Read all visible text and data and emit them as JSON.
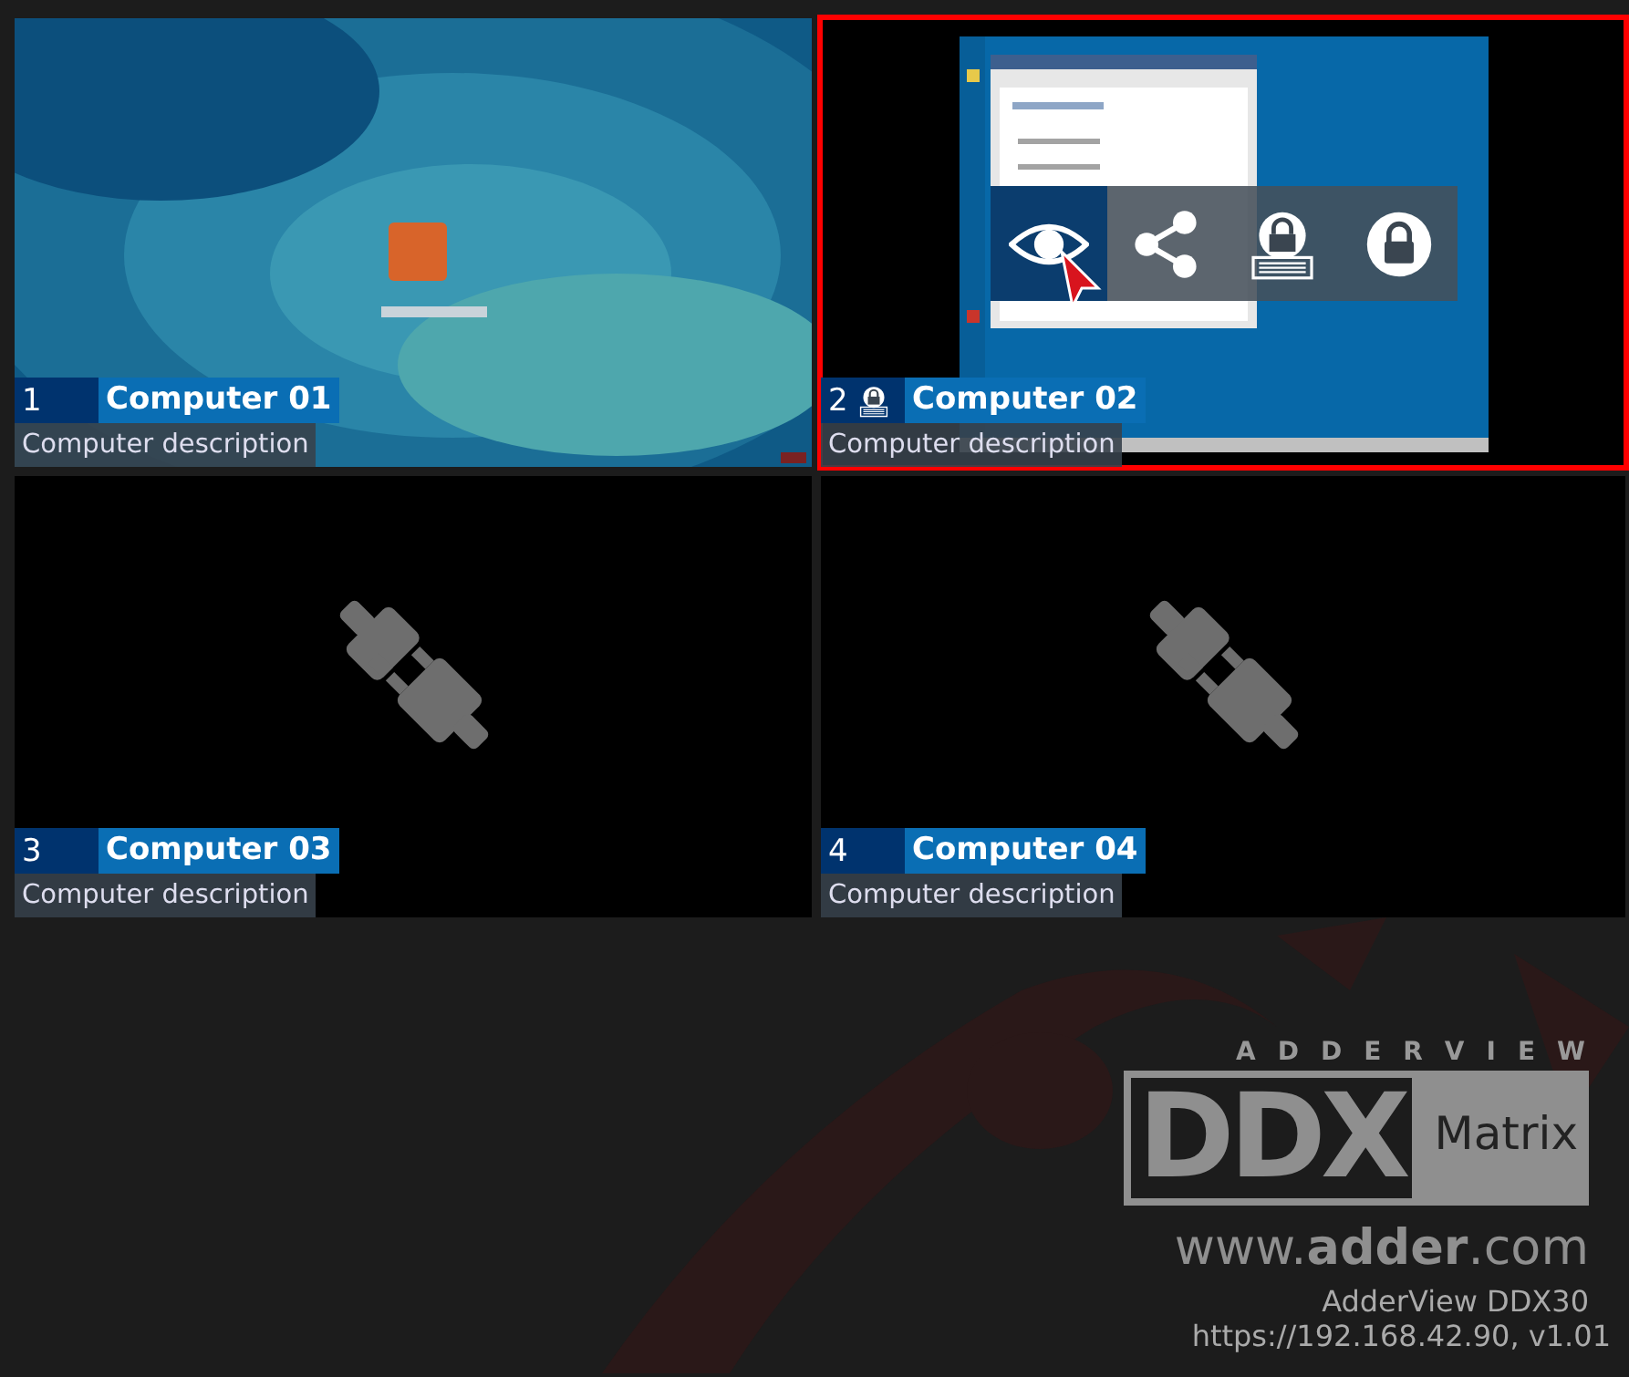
{
  "tiles": [
    {
      "number": "1",
      "name": "Computer 01",
      "description": "Computer description",
      "kind": "picture",
      "locked": false,
      "selected": false
    },
    {
      "number": "2",
      "name": "Computer 02",
      "description": "Computer description",
      "kind": "picture",
      "locked": true,
      "selected": true,
      "actions": [
        {
          "kind": "view",
          "selected": true
        },
        {
          "kind": "share",
          "selected": false
        },
        {
          "kind": "lock-keyboard",
          "selected": false
        },
        {
          "kind": "lock",
          "selected": false
        }
      ]
    },
    {
      "number": "3",
      "name": "Computer 03",
      "description": "Computer description",
      "kind": "disconnected",
      "locked": false,
      "selected": false
    },
    {
      "number": "4",
      "name": "Computer 04",
      "description": "Computer description",
      "kind": "disconnected",
      "locked": false,
      "selected": false
    }
  ],
  "footer": {
    "brand": "ADDERVIEW",
    "logo_main": "DDX",
    "logo_sub": "Matrix",
    "website": "www.**adder**.com",
    "model": "AdderView DDX30",
    "address": "https://192.168.42.90, v1.01"
  }
}
